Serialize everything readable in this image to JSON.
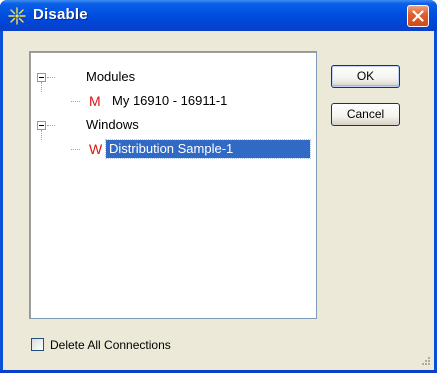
{
  "window": {
    "title": "Disable",
    "title_icon": "agilent-spark-icon",
    "close_icon": "close-icon"
  },
  "tree": {
    "groups": [
      {
        "label": "Modules",
        "expanded": true,
        "children": [
          {
            "type_letter": "M",
            "label": "My 16910 - 16911-1",
            "selected": false
          }
        ]
      },
      {
        "label": "Windows",
        "expanded": true,
        "children": [
          {
            "type_letter": "W",
            "label": "Distribution Sample-1",
            "selected": true
          }
        ]
      }
    ]
  },
  "buttons": {
    "ok_label": "OK",
    "cancel_label": "Cancel"
  },
  "options": {
    "delete_all_connections_label": "Delete All Connections",
    "delete_all_connections_checked": false
  },
  "colors": {
    "title_bar": "#0050e0",
    "selection": "#316ac5",
    "type_letter": "#e01010",
    "dialog_face": "#ece9d8"
  }
}
